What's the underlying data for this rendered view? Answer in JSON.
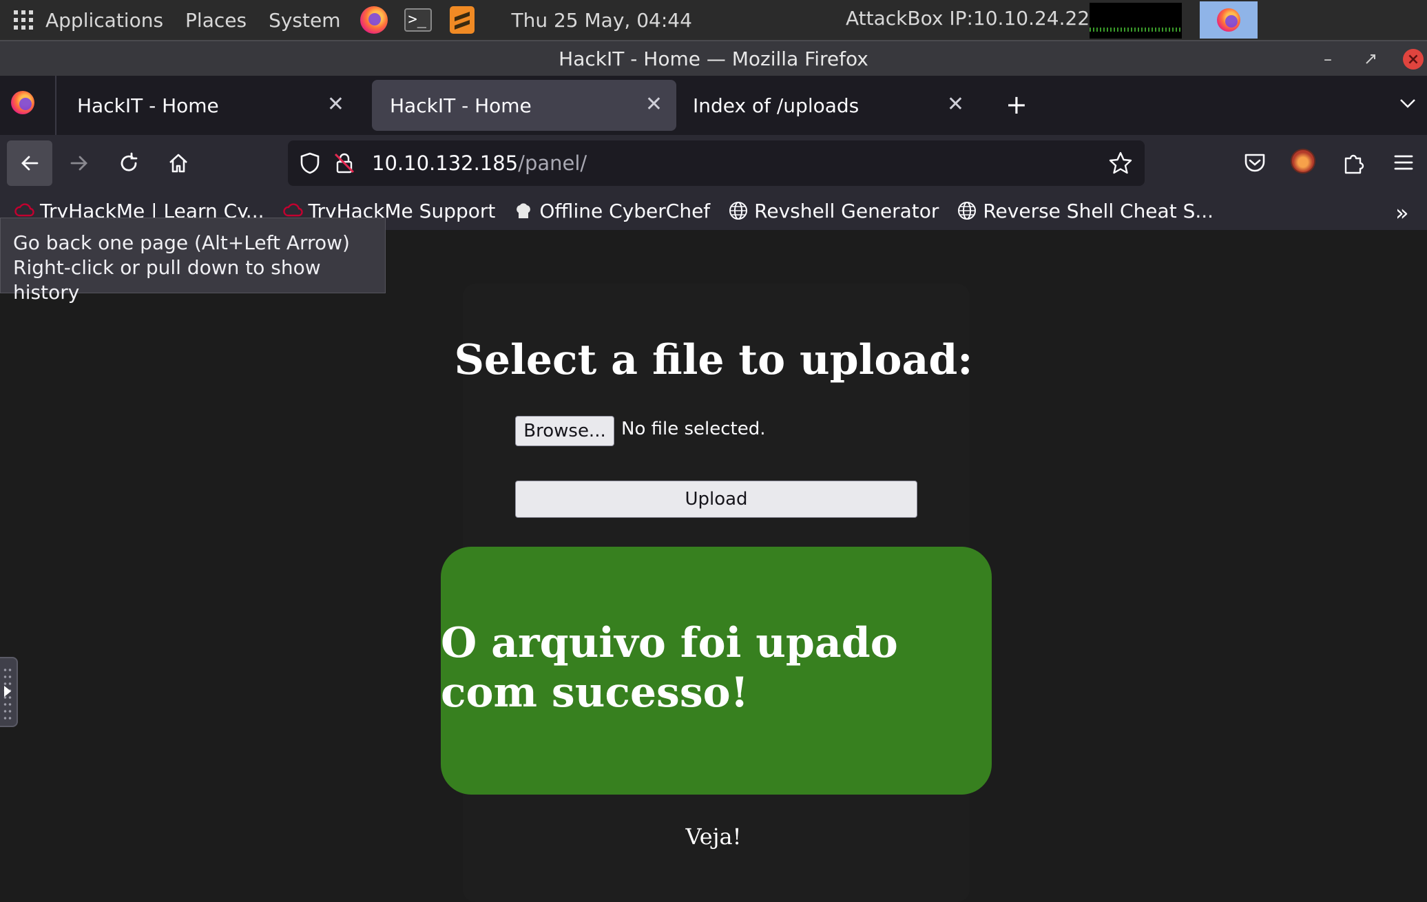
{
  "os_panel": {
    "menus": [
      "Applications",
      "Places",
      "System"
    ],
    "clock": "Thu 25 May, 04:44",
    "ip": "AttackBox IP:10.10.24.228"
  },
  "window": {
    "title": "HackIT - Home — Mozilla Firefox"
  },
  "tabs": [
    {
      "label": "HackIT - Home",
      "active": false
    },
    {
      "label": "HackIT - Home",
      "active": true
    },
    {
      "label": "Index of /uploads",
      "active": false
    }
  ],
  "navbar": {
    "url_host": "10.10.132.185",
    "url_path": "/panel/"
  },
  "bookmarks": [
    {
      "label": "TryHackMe | Learn Cy...",
      "icon": "cloud-icon"
    },
    {
      "label": "TryHackMe Support",
      "icon": "cloud-icon"
    },
    {
      "label": "Offline CyberChef",
      "icon": "chef-hat-icon"
    },
    {
      "label": "Revshell Generator",
      "icon": "globe-icon"
    },
    {
      "label": "Reverse Shell Cheat S...",
      "icon": "globe-icon"
    }
  ],
  "tooltip": {
    "line1": "Go back one page (Alt+Left Arrow)",
    "line2": "Right-click or pull down to show history"
  },
  "page": {
    "heading": "Select a file to upload:",
    "browse_label": "Browse...",
    "file_status": "No file selected.",
    "upload_label": "Upload",
    "success_message": "O arquivo foi upado com sucesso!",
    "link_text": "Veja!"
  },
  "colors": {
    "success_bg": "#37801f",
    "page_bg": "#1c1c1c",
    "active_tab": "#42414d"
  }
}
